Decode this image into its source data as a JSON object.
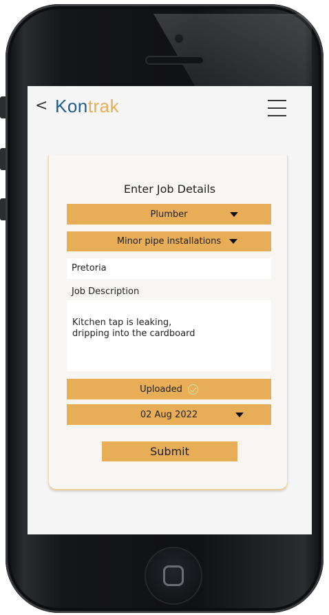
{
  "header": {
    "back_glyph": "<",
    "logo_part1": "Kon",
    "logo_part2": "trak"
  },
  "form": {
    "title": "Enter Job Details",
    "trade_select": "Plumber",
    "service_select": "Minor pipe installations",
    "location_value": "Pretoria",
    "description_label": "Job Description",
    "description_value": "Kitchen tap is leaking,\ndripping into the cardboard",
    "upload_status": "Uploaded",
    "date_select": "02 Aug 2022",
    "submit_label": "Submit"
  },
  "colors": {
    "accent": "#e8ad57",
    "logo_blue": "#1f5c8f",
    "logo_orange": "#e8ad57",
    "check_green": "#cfe7a8"
  },
  "icons": {
    "back": "chevron-left-icon",
    "menu": "hamburger-menu-icon",
    "dropdown": "caret-down-icon",
    "upload_ok": "check-circle-icon"
  }
}
